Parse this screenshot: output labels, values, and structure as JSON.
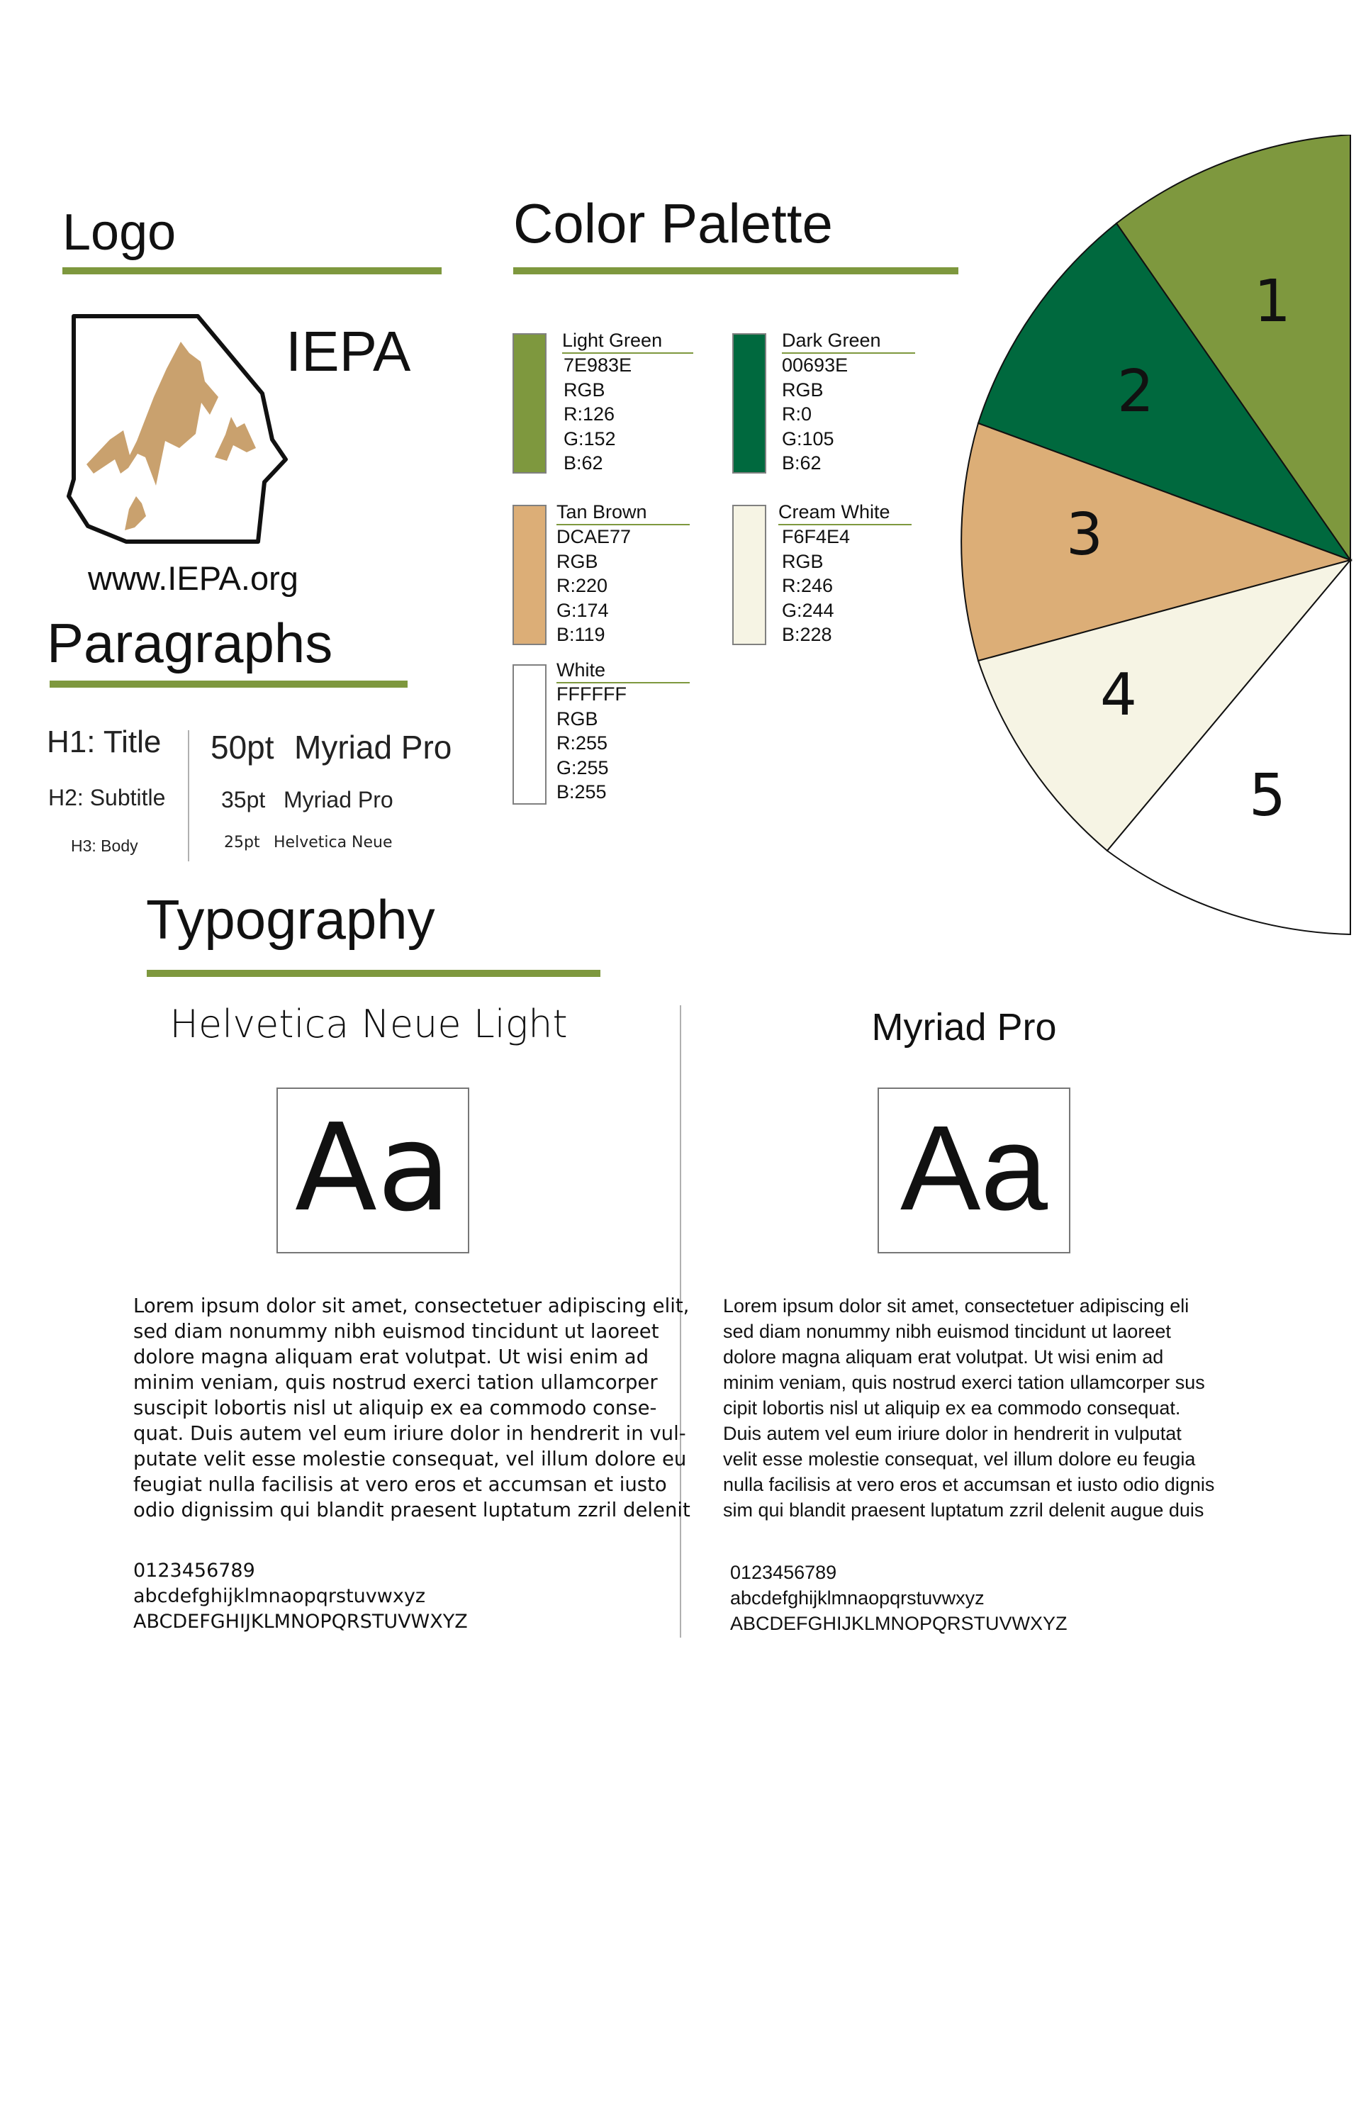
{
  "logo": {
    "heading": "Logo",
    "brand": "IEPA",
    "url": "www.IEPA.org"
  },
  "color_palette": {
    "heading": "Color Palette",
    "swatches": [
      {
        "name": "Light Green",
        "hex": "7E983E",
        "rgb_label": "RGB",
        "r": "R:126",
        "g": "G:152",
        "b": "B:62",
        "color": "#7E983E"
      },
      {
        "name": "Dark Green",
        "hex": "00693E",
        "rgb_label": "RGB",
        "r": "R:0",
        "g": "G:105",
        "b": "B:62",
        "color": "#00693E"
      },
      {
        "name": "Tan Brown",
        "hex": "DCAE77",
        "rgb_label": "RGB",
        "r": "R:220",
        "g": "G:174",
        "b": "B:119",
        "color": "#DCAE77"
      },
      {
        "name": "Cream White",
        "hex": "F6F4E4",
        "rgb_label": "RGB",
        "r": "R:246",
        "g": "G:244",
        "b": "B:228",
        "color": "#F6F4E4"
      },
      {
        "name": "White",
        "hex": "FFFFFF",
        "rgb_label": "RGB",
        "r": "R:255",
        "g": "G:255",
        "b": "B:255",
        "color": "#FFFFFF"
      }
    ]
  },
  "pie": {
    "labels": [
      "1",
      "2",
      "3",
      "4",
      "5"
    ],
    "colors": [
      "#7E983E",
      "#00693E",
      "#DCAE77",
      "#F6F4E4",
      "#FFFFFF"
    ]
  },
  "paragraphs": {
    "heading": "Paragraphs",
    "styles": [
      {
        "label": "H1: Title",
        "size": "50pt",
        "font": "Myriad Pro"
      },
      {
        "label": "H2: Subtitle",
        "size": "35pt",
        "font": "Myriad Pro"
      },
      {
        "label": "H3: Body",
        "size": "25pt",
        "font": "Helvetica Neue"
      }
    ]
  },
  "typography": {
    "heading": "Typography",
    "fonts": [
      {
        "name": "Helvetica Neue Light",
        "sample": "Aa",
        "lorem": [
          "Lorem ipsum dolor sit amet, consectetuer adipiscing elit,",
          "sed diam nonummy nibh euismod tincidunt ut laoreet",
          "dolore magna aliquam erat volutpat. Ut wisi enim ad",
          "minim veniam, quis nostrud exerci tation ullamcorper",
          "suscipit lobortis nisl ut aliquip ex ea commodo conse-",
          "quat. Duis autem vel eum iriure dolor in hendrerit in vul-",
          "putate velit esse molestie consequat, vel illum dolore eu",
          "feugiat nulla facilisis at vero eros et accumsan et iusto",
          "odio dignissim qui blandit praesent luptatum zzril delenit"
        ],
        "digits": "0123456789",
        "lowercase": "abcdefghijklmnaopqrstuvwxyz",
        "uppercase": "ABCDEFGHIJKLMNOPQRSTUVWXYZ"
      },
      {
        "name": "Myriad Pro",
        "sample": "Aa",
        "lorem": [
          "Lorem ipsum dolor sit amet, consectetuer adipiscing eli",
          "sed diam nonummy nibh euismod tincidunt ut laoreet",
          "dolore magna aliquam erat volutpat. Ut wisi enim ad",
          "minim veniam, quis nostrud exerci tation ullamcorper sus",
          "cipit lobortis nisl ut aliquip ex ea commodo consequat.",
          "Duis autem vel eum iriure dolor in hendrerit in vulputat",
          "velit esse molestie consequat, vel illum dolore eu feugia",
          "nulla facilisis at vero eros et accumsan et iusto odio dignis",
          "sim qui blandit praesent luptatum zzril delenit augue duis"
        ],
        "digits": "0123456789",
        "lowercase": "abcdefghijklmnaopqrstuvwxyz",
        "uppercase": "ABCDEFGHIJKLMNOPQRSTUVWXYZ"
      }
    ]
  }
}
